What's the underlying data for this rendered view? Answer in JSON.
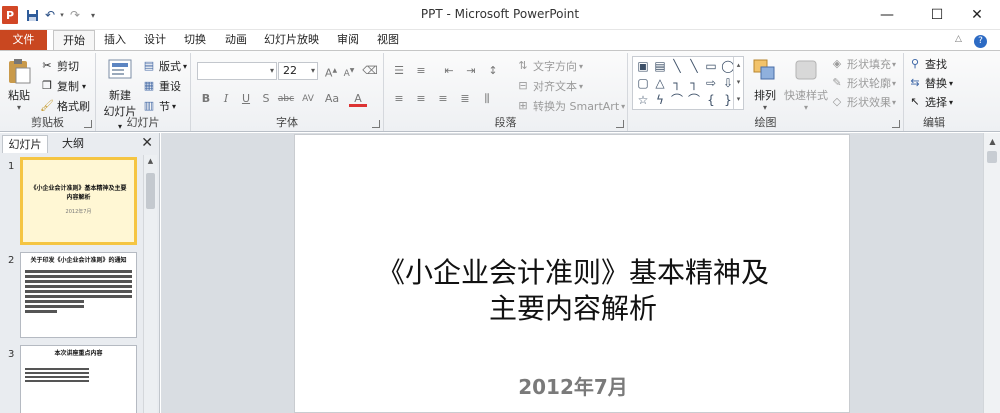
{
  "window": {
    "title": "PPT - Microsoft PowerPoint",
    "app_icon_letter": "P",
    "quick_access": [
      "save-icon",
      "undo-icon",
      "redo-icon",
      "customize-icon"
    ],
    "controls": {
      "minimize": "—",
      "maximize": "☐",
      "close": "✕"
    }
  },
  "ribbon_tabs": [
    "文件",
    "开始",
    "插入",
    "设计",
    "切换",
    "动画",
    "幻灯片放映",
    "审阅",
    "视图"
  ],
  "active_tab": "开始",
  "ribbon": {
    "clipboard": {
      "label": "剪贴板",
      "paste": "粘贴",
      "cut": "剪切",
      "copy": "复制",
      "format_painter": "格式刷"
    },
    "slides": {
      "label": "幻灯片",
      "new_slide_line1": "新建",
      "new_slide_line2": "幻灯片",
      "layout": "版式",
      "reset": "重设",
      "section": "节"
    },
    "font": {
      "label": "字体",
      "font_name": "",
      "font_size": "22",
      "buttons": [
        "B",
        "I",
        "U",
        "S",
        "abc",
        "AV",
        "Aa",
        "A"
      ]
    },
    "paragraph": {
      "label": "段落",
      "text_direction": "文字方向",
      "align_text": "对齐文本",
      "convert_smartart": "转换为 SmartArt"
    },
    "drawing": {
      "label": "绘图",
      "arrange": "排列",
      "quick_styles": "快速样式",
      "shape_fill": "形状填充",
      "shape_outline": "形状轮廓",
      "shape_effects": "形状效果"
    },
    "editing": {
      "label": "编辑",
      "find": "查找",
      "replace": "替换",
      "select": "选择"
    }
  },
  "left_panel": {
    "tabs": [
      "幻灯片",
      "大纲"
    ],
    "close": "✕",
    "thumbnails": [
      {
        "num": "1",
        "title": "《小企业会计准则》基本精神及主要内容解析",
        "sub": "2012年7月"
      },
      {
        "num": "2",
        "title": "关于印发《小企业会计准则》的通知"
      },
      {
        "num": "3",
        "title": "本次讲座重点内容"
      }
    ]
  },
  "slide": {
    "title_line1": "《小企业会计准则》基本精神及",
    "title_line2": "主要内容解析",
    "subtitle": "2012年7月"
  },
  "colors": {
    "file_tab": "#c94720",
    "selected_thumb": "#f5c542",
    "app_icon": "#d24726"
  }
}
